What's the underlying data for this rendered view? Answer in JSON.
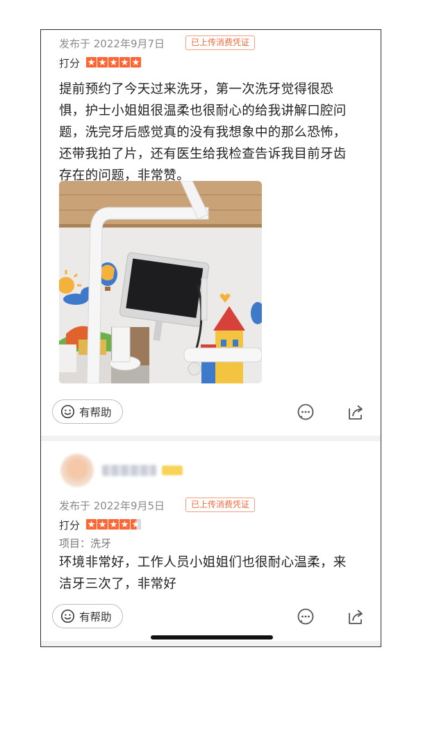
{
  "reviews": [
    {
      "date": "发布于 2022年9月7日",
      "verified_badge": "已上传消费凭证",
      "score_label": "打分",
      "rating": 5,
      "text_lines": [
        "提前预约了今天过来洗牙，第一次洗牙觉得很恐",
        "惧，护士小姐姐很温柔也很耐心的给我讲解口腔问",
        "题，洗完牙后感觉真的没有我想象中的那么恐怖，",
        "还带我拍了片，还有医生给我检查告诉我目前牙齿",
        "存在的问题，非常赞。"
      ],
      "helpful_label": "有帮助"
    },
    {
      "date": "发布于 2022年9月5日",
      "verified_badge": "已上传消费凭证",
      "score_label": "打分",
      "rating": 4.5,
      "project": "项目：洗牙",
      "text_lines": [
        "环境非常好，工作人员小姐姐们也很耐心温柔，来",
        "洁牙三次了，非常好"
      ],
      "helpful_label": "有帮助"
    }
  ],
  "colors": {
    "accent": "#ff6433",
    "badge_text": "#f06a3c",
    "meta_text": "#8a8a8a",
    "divider": "#f2f2f2"
  },
  "icons": [
    "smile-icon",
    "comment-icon",
    "share-icon"
  ]
}
